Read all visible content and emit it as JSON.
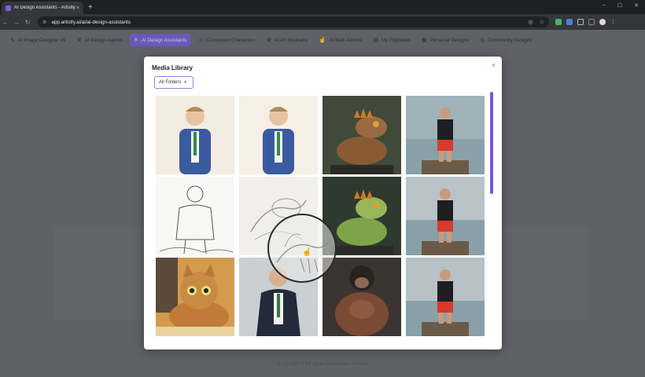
{
  "browser": {
    "tab_title": "AI Design Assistants - Artistly",
    "tab_close": "×",
    "new_tab": "+",
    "url": "app.artistly.ai/ai/ai-design-assistants",
    "window_controls": [
      "–",
      "☐",
      "✕"
    ]
  },
  "nav": {
    "items": [
      {
        "label": "AI Image Designer v5",
        "icon": "brush-icon"
      },
      {
        "label": "AI Design Agents",
        "icon": "wand-icon"
      },
      {
        "label": "AI Design Assistants",
        "icon": "cross-tools-icon",
        "active": true
      },
      {
        "label": "Consistent Characters",
        "icon": "person-icon"
      },
      {
        "label": "AI Art Illustrator",
        "icon": "palette-icon"
      },
      {
        "label": "AI Bulk Actions",
        "icon": "pointer-icon"
      },
      {
        "label": "My Flipbooks",
        "icon": "book-icon"
      },
      {
        "label": "Personal Designs",
        "icon": "folder-icon"
      },
      {
        "label": "Community Designs",
        "icon": "globe-icon"
      }
    ]
  },
  "modal": {
    "title": "Media Library",
    "close": "×",
    "folder_select": "All Folders"
  },
  "media": [
    {
      "name": "man-blue-suit-sketch-1",
      "bg": "#f3ece3"
    },
    {
      "name": "man-blue-suit-sketch-2",
      "bg": "#f5efe6"
    },
    {
      "name": "iguana-brown-photo",
      "bg": "#3f4a3a"
    },
    {
      "name": "man-red-shorts-dock-1",
      "bg": "#9fb2b8"
    },
    {
      "name": "man-jacket-line-sketch",
      "bg": "#f7f7f5"
    },
    {
      "name": "iguana-pencil-sketch",
      "bg": "#f0efec"
    },
    {
      "name": "iguana-green-photo",
      "bg": "#2e3a2e"
    },
    {
      "name": "man-red-shorts-dock-2",
      "bg": "#b9c3c7"
    },
    {
      "name": "cartoon-tabby-cat",
      "bg": "#d49a4e"
    },
    {
      "name": "man-navy-suit-photo",
      "bg": "#c9cfd3"
    },
    {
      "name": "muscular-chimp",
      "bg": "#3a3532"
    },
    {
      "name": "man-red-shorts-dock-3",
      "bg": "#b7c1c6"
    }
  ],
  "footer": "Copyright © All rights Reserved - Artistly",
  "colors": {
    "accent": "#7357e6",
    "close": "#e0645c"
  }
}
